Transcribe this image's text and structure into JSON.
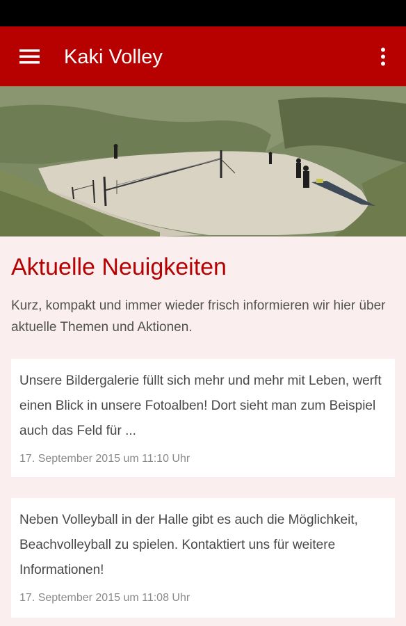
{
  "app_bar": {
    "title": "Kaki Volley",
    "menu_icon": "hamburger-menu-icon",
    "overflow_icon": "more-vertical-icon"
  },
  "hero": {
    "description": "beach volleyball court in sand dunes"
  },
  "news": {
    "heading": "Aktuelle Neuigkeiten",
    "intro": "Kurz, kompakt und immer wieder frisch informieren wir hier über aktuelle Themen und Aktionen.",
    "items": [
      {
        "text": "Unsere Bildergalerie füllt sich mehr und mehr mit Leben, werft einen Blick in unsere Fotoalben! Dort sieht man zum Beispiel auch das Feld für ...",
        "date": "17. September 2015 um 11:10 Uhr"
      },
      {
        "text": "Neben Volleyball in der Halle gibt es auch die Möglichkeit, Beachvolleyball zu spielen. Kontaktiert uns für weitere Informationen!",
        "date": "17. September 2015 um 11:08 Uhr"
      }
    ]
  },
  "colors": {
    "primary": "#b70000",
    "background": "#fbeeef",
    "status_bar": "#000000",
    "card": "#ffffff"
  }
}
